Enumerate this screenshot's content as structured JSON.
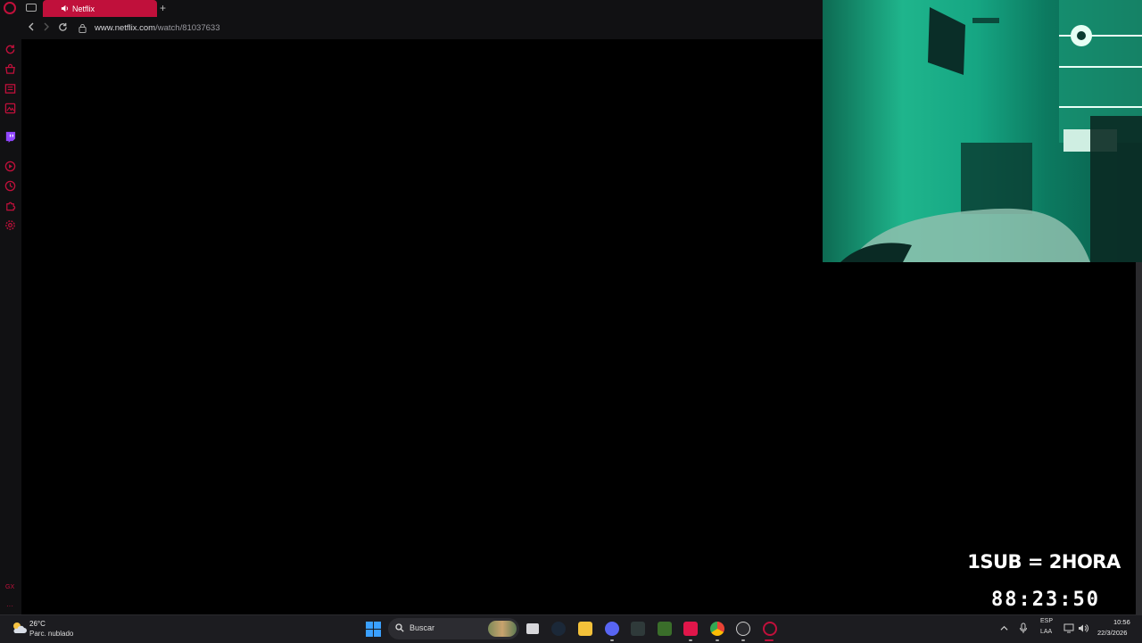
{
  "browser": {
    "tab_title": "Netflix",
    "new_tab_label": "+",
    "url_domain": "www.netflix.com",
    "url_path": "/watch/81037633"
  },
  "overlay": {
    "sub_text": "1SUB = 2HORA",
    "timer": "88:23:50"
  },
  "sidebar": {
    "bottom_label": "GX",
    "icons": [
      "refresh-icon",
      "shop-icon",
      "news-icon",
      "gallery-icon",
      "twitch-icon",
      "player-icon",
      "history-icon",
      "extensions-icon",
      "settings-icon"
    ]
  },
  "taskbar": {
    "weather_temp": "26°C",
    "weather_condition": "Parc. nublado",
    "search_placeholder": "Buscar",
    "lang_line1": "ESP",
    "lang_line2": "LAA",
    "clock_time": "10:56",
    "clock_date": "22/3/2026",
    "apps": [
      "task-view",
      "steam",
      "file-explorer",
      "discord",
      "terminal",
      "nvidia",
      "tiktok",
      "chrome",
      "obs",
      "opera-gx"
    ]
  },
  "colors": {
    "accent": "#c0103b",
    "webcam_tint": "#1fb58c"
  }
}
